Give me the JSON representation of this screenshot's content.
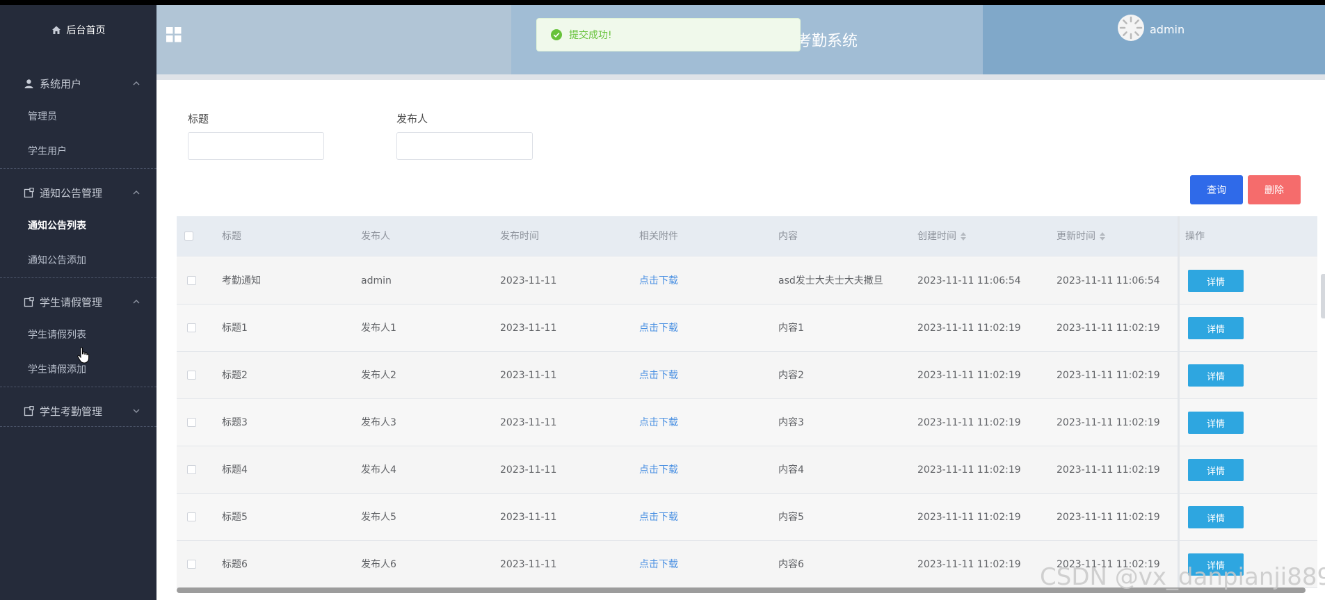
{
  "sidebar": {
    "home": "后台首页",
    "groups": [
      {
        "title": "系统用户",
        "items": [
          "管理员",
          "学生用户"
        ]
      },
      {
        "title": "通知公告管理",
        "items": [
          "通知公告列表",
          "通知公告添加"
        ]
      },
      {
        "title": "学生请假管理",
        "items": [
          "学生请假列表",
          "学生请假添加"
        ]
      },
      {
        "title": "学生考勤管理",
        "items": []
      }
    ]
  },
  "header": {
    "title": "考勤系统",
    "user": "admin"
  },
  "toast": {
    "message": "提交成功!"
  },
  "search": {
    "title_label": "标题",
    "publisher_label": "发布人",
    "title_value": "",
    "publisher_value": ""
  },
  "buttons": {
    "query": "查询",
    "delete": "删除",
    "detail": "详情"
  },
  "table": {
    "headers": [
      "标题",
      "发布人",
      "发布时间",
      "相关附件",
      "内容",
      "创建时间",
      "更新时间",
      "操作"
    ],
    "rows": [
      {
        "title": "考勤通知",
        "publisher": "admin",
        "publish_time": "2023-11-11",
        "attachment": "点击下载",
        "content": "asd发士大夫士大夫撒旦",
        "created": "2023-11-11 11:06:54",
        "updated": "2023-11-11 11:06:54"
      },
      {
        "title": "标题1",
        "publisher": "发布人1",
        "publish_time": "2023-11-11",
        "attachment": "点击下载",
        "content": "内容1",
        "created": "2023-11-11 11:02:19",
        "updated": "2023-11-11 11:02:19"
      },
      {
        "title": "标题2",
        "publisher": "发布人2",
        "publish_time": "2023-11-11",
        "attachment": "点击下载",
        "content": "内容2",
        "created": "2023-11-11 11:02:19",
        "updated": "2023-11-11 11:02:19"
      },
      {
        "title": "标题3",
        "publisher": "发布人3",
        "publish_time": "2023-11-11",
        "attachment": "点击下载",
        "content": "内容3",
        "created": "2023-11-11 11:02:19",
        "updated": "2023-11-11 11:02:19"
      },
      {
        "title": "标题4",
        "publisher": "发布人4",
        "publish_time": "2023-11-11",
        "attachment": "点击下载",
        "content": "内容4",
        "created": "2023-11-11 11:02:19",
        "updated": "2023-11-11 11:02:19"
      },
      {
        "title": "标题5",
        "publisher": "发布人5",
        "publish_time": "2023-11-11",
        "attachment": "点击下载",
        "content": "内容5",
        "created": "2023-11-11 11:02:19",
        "updated": "2023-11-11 11:02:19"
      },
      {
        "title": "标题6",
        "publisher": "发布人6",
        "publish_time": "2023-11-11",
        "attachment": "点击下载",
        "content": "内容6",
        "created": "2023-11-11 11:02:19",
        "updated": "2023-11-11 11:02:19"
      }
    ]
  },
  "watermark": "CSDN @vx_danpianji889",
  "colors": {
    "sidebar_bg": "#252b3a",
    "primary": "#2f6ae9",
    "danger": "#f56c6c",
    "detail": "#2ea6e0",
    "success": "#67c23a"
  }
}
